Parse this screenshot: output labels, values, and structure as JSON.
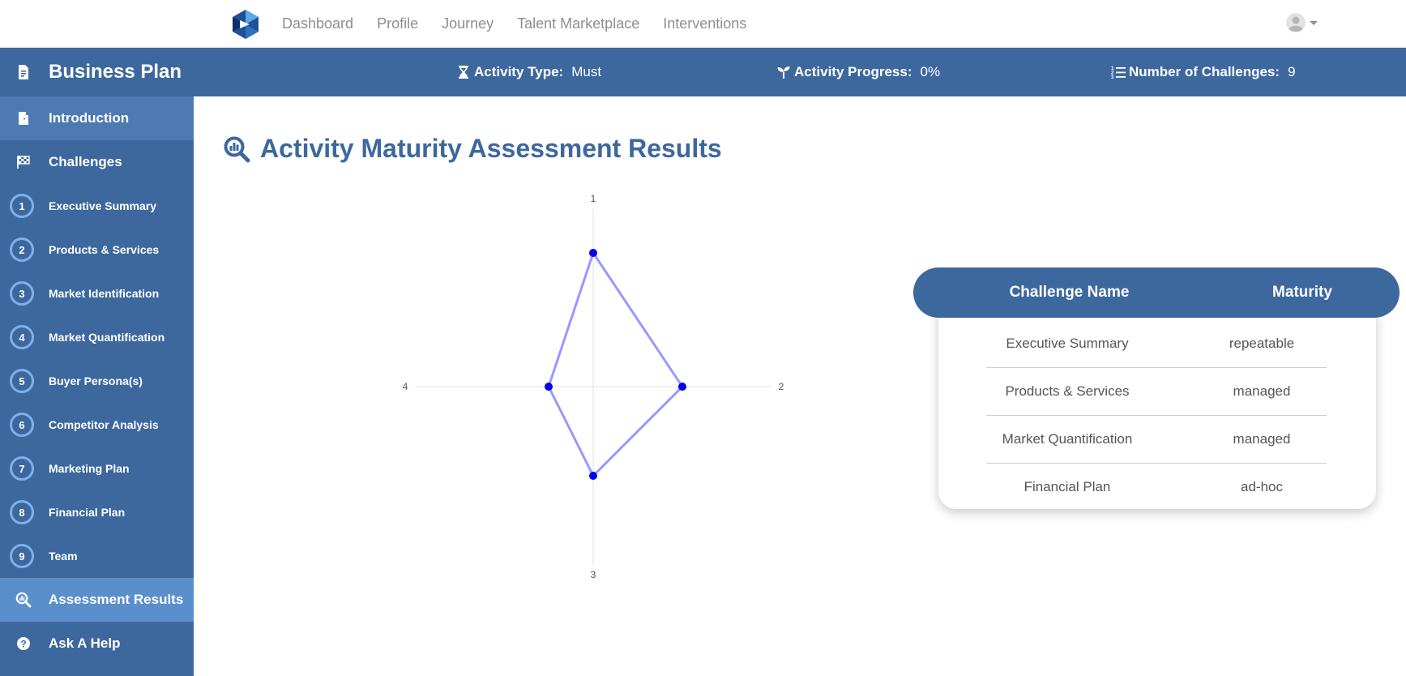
{
  "nav": {
    "links": [
      "Dashboard",
      "Profile",
      "Journey",
      "Talent Marketplace",
      "Interventions"
    ]
  },
  "sidebar": {
    "header": "Business Plan",
    "introduction": "Introduction",
    "challenges": "Challenges",
    "items": [
      {
        "num": "1",
        "label": "Executive Summary"
      },
      {
        "num": "2",
        "label": "Products & Services"
      },
      {
        "num": "3",
        "label": "Market Identification"
      },
      {
        "num": "4",
        "label": "Market Quantification"
      },
      {
        "num": "5",
        "label": "Buyer Persona(s)"
      },
      {
        "num": "6",
        "label": "Competitor Analysis"
      },
      {
        "num": "7",
        "label": "Marketing Plan"
      },
      {
        "num": "8",
        "label": "Financial Plan"
      },
      {
        "num": "9",
        "label": "Team"
      }
    ],
    "assessment": "Assessment Results",
    "help": "Ask A Help"
  },
  "stats": {
    "activity_type_label": "Activity Type:",
    "activity_type_value": "Must",
    "progress_label": "Activity Progress:",
    "progress_value": "0%",
    "challenges_label": "Number of Challenges:",
    "challenges_value": "9"
  },
  "page_title": "Activity Maturity Assessment Results",
  "chart_data": {
    "type": "radar",
    "axes": [
      "1",
      "2",
      "3",
      "4"
    ],
    "values": [
      3,
      2,
      2,
      1
    ],
    "max": 4,
    "grid": true,
    "colors": {
      "line": "#9999ff",
      "point": "#0000ee",
      "axis": "#e2e2e2"
    }
  },
  "table": {
    "headers": [
      "Challenge Name",
      "Maturity"
    ],
    "rows": [
      {
        "name": "Executive Summary",
        "maturity": "repeatable"
      },
      {
        "name": "Products & Services",
        "maturity": "managed"
      },
      {
        "name": "Market Quantification",
        "maturity": "managed"
      },
      {
        "name": "Financial Plan",
        "maturity": "ad-hoc"
      }
    ]
  },
  "colors": {
    "brand": "#3d689e",
    "intro_bg": "#4e7ab2",
    "active_bg": "#5b8fcb"
  }
}
